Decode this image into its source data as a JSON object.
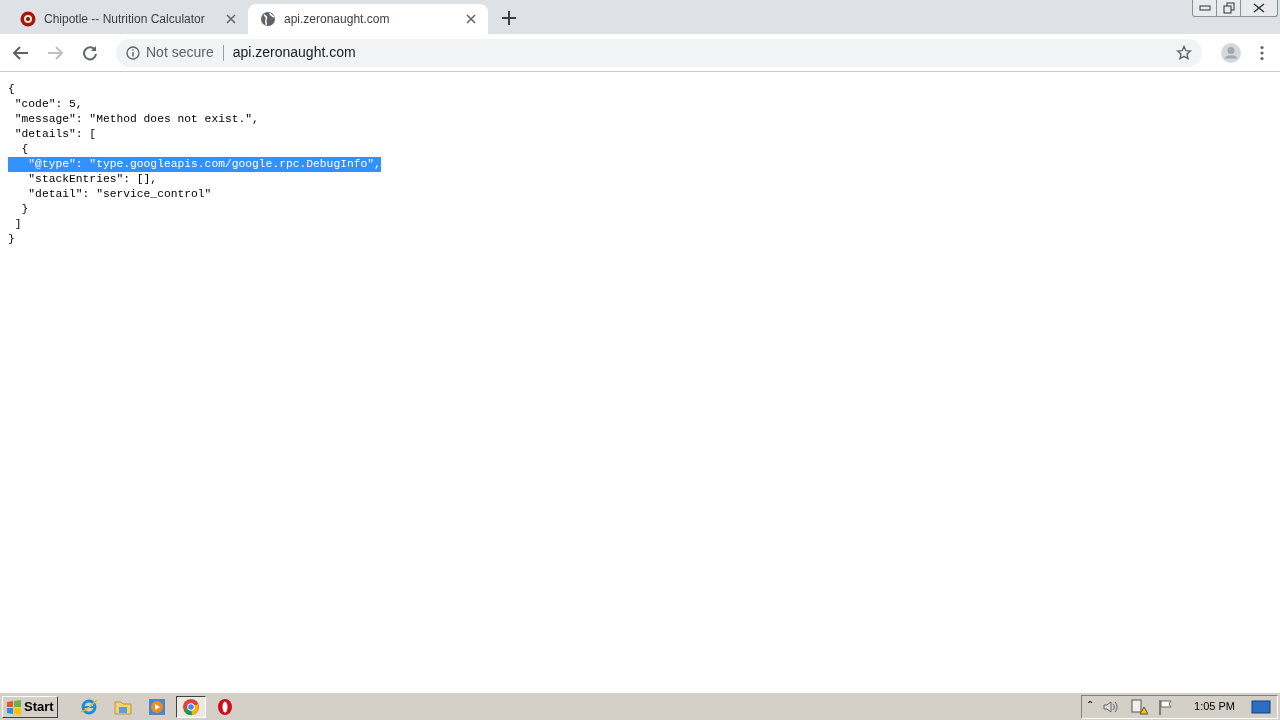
{
  "tabs": [
    {
      "title": "Chipotle -- Nutrition Calculator",
      "kind": "logo",
      "selected": false
    },
    {
      "title": "api.zeronaught.com",
      "kind": "globe",
      "selected": true
    }
  ],
  "address_bar": {
    "security": "Not secure",
    "url": "api.zeronaught.com"
  },
  "content": {
    "lines": [
      {
        "text": "{",
        "selected": false
      },
      {
        "text": " \"code\": 5,",
        "selected": false
      },
      {
        "text": " \"message\": \"Method does not exist.\",",
        "selected": false
      },
      {
        "text": " \"details\": [",
        "selected": false
      },
      {
        "text": "  {",
        "selected": false
      },
      {
        "text": "   \"@type\": \"type.googleapis.com/google.rpc.DebugInfo\",",
        "selected": true
      },
      {
        "text": "   \"stackEntries\": [],",
        "selected": false
      },
      {
        "text": "   \"detail\": \"service_control\"",
        "selected": false
      },
      {
        "text": "  }",
        "selected": false
      },
      {
        "text": " ]",
        "selected": false
      },
      {
        "text": "}",
        "selected": false
      }
    ]
  },
  "taskbar": {
    "start": "Start",
    "apps": [
      {
        "kind": "ie",
        "selected": false
      },
      {
        "kind": "folder",
        "selected": false
      },
      {
        "kind": "media",
        "selected": false
      },
      {
        "kind": "chrome",
        "selected": true
      },
      {
        "kind": "opera",
        "selected": false
      }
    ],
    "tray_arrow": "ˆ",
    "time": "1:05 PM"
  }
}
